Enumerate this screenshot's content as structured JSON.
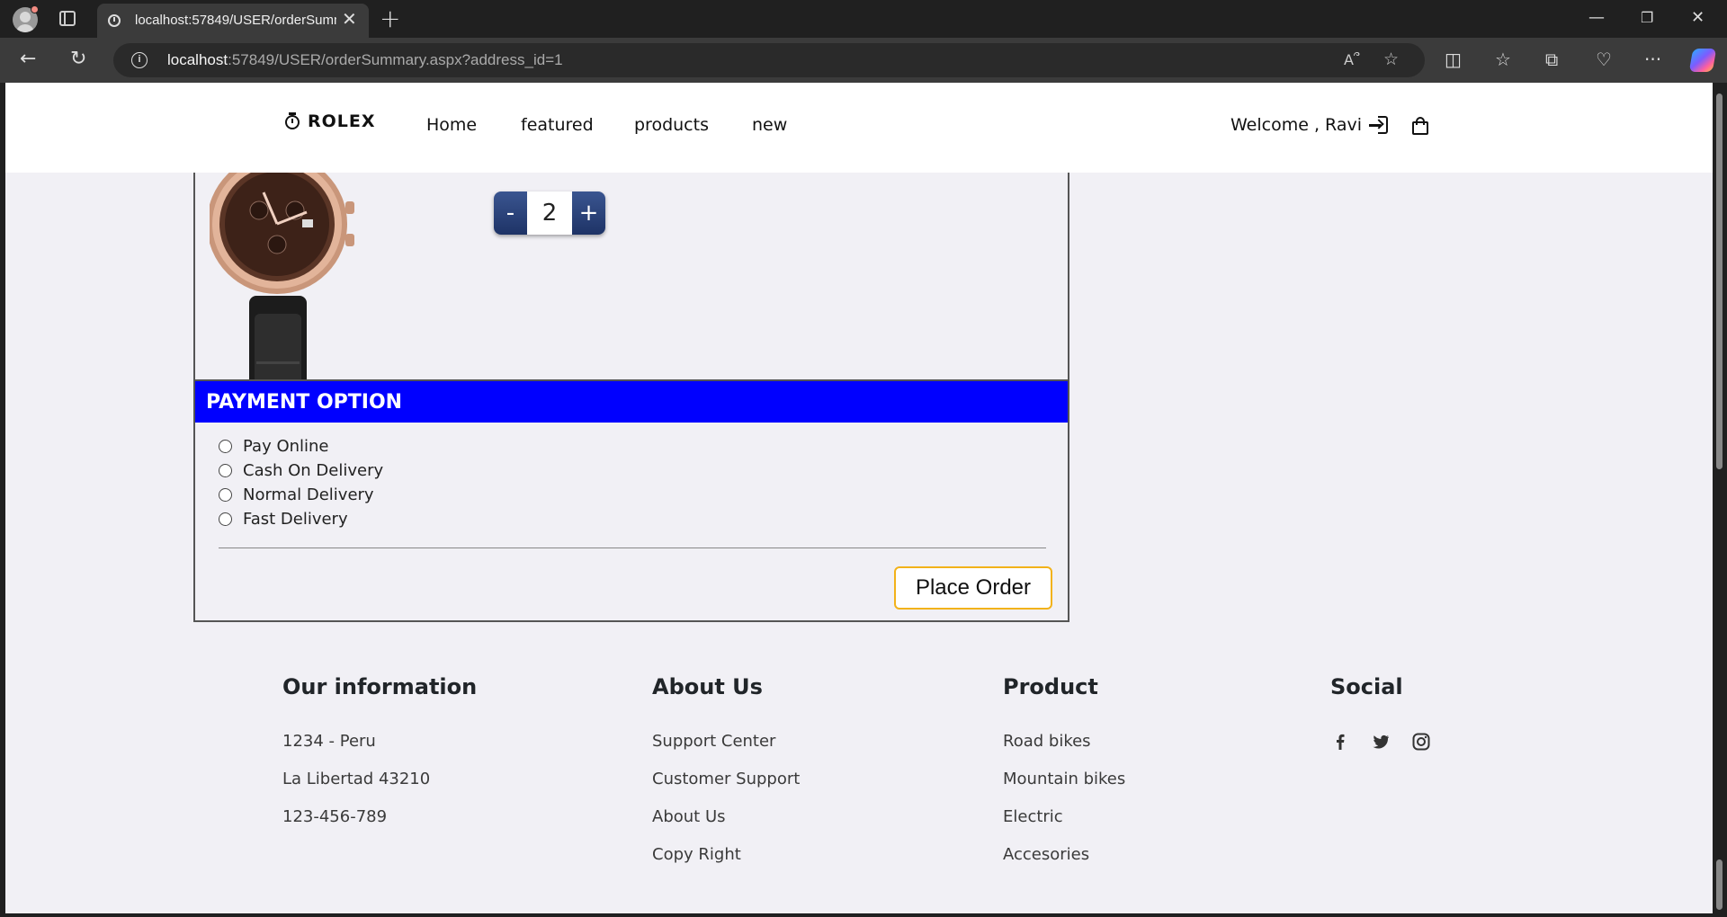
{
  "browser": {
    "tab_title": "localhost:57849/USER/orderSummary.aspx?address_id=1",
    "url_host": "localhost",
    "url_rest": ":57849/USER/orderSummary.aspx?address_id=1"
  },
  "site": {
    "logo": "ROLEX",
    "nav": [
      "Home",
      "featured",
      "products",
      "new"
    ],
    "welcome": "Welcome , Ravi"
  },
  "product": {
    "quantity": "2",
    "minus_label": "-",
    "plus_label": "+"
  },
  "payment": {
    "title": "PAYMENT OPTION",
    "options": [
      "Pay Online",
      "Cash On Delivery",
      "Normal Delivery",
      "Fast Delivery"
    ],
    "place_order_label": "Place Order"
  },
  "footer": {
    "info": {
      "title": "Our information",
      "items": [
        "1234 - Peru",
        "La Libertad 43210",
        "123-456-789"
      ]
    },
    "about": {
      "title": "About Us",
      "items": [
        "Support Center",
        "Customer Support",
        "About Us",
        "Copy Right"
      ]
    },
    "product": {
      "title": "Product",
      "items": [
        "Road bikes",
        "Mountain bikes",
        "Electric",
        "Accesories"
      ]
    },
    "social": {
      "title": "Social",
      "icons": [
        "facebook-icon",
        "twitter-icon",
        "instagram-icon"
      ]
    }
  },
  "colors": {
    "payment_header": "#0000ff",
    "place_order_border": "#f2b21a",
    "qty_button": "#1e3366",
    "page_background": "#f1f0f5"
  }
}
